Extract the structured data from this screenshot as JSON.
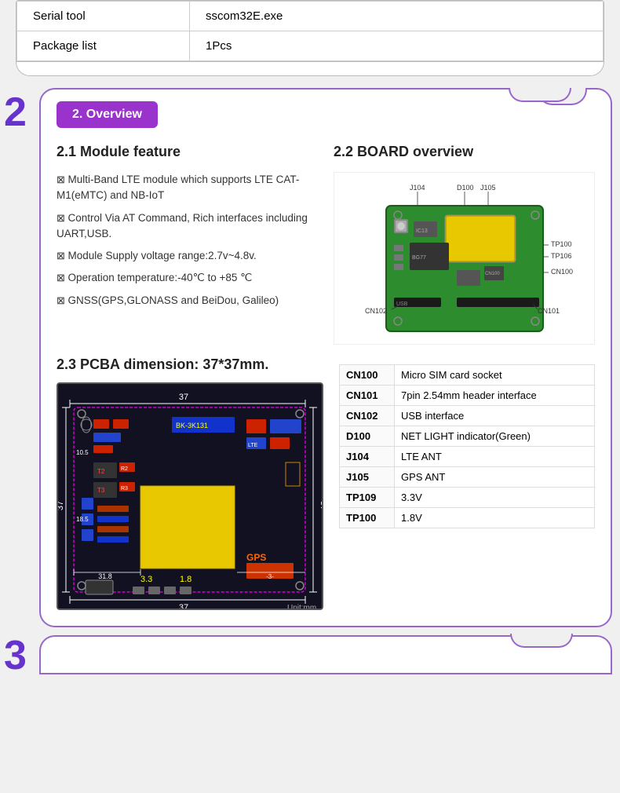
{
  "top_table": {
    "rows": [
      {
        "label": "Serial tool",
        "value": "sscom32E.exe"
      },
      {
        "label": "Package list",
        "value": "1Pcs"
      }
    ]
  },
  "section2": {
    "number": "2",
    "header": "2. Overview",
    "module_feature": {
      "title": "2.1 Module feature",
      "features": [
        "Multi-Band LTE module which supports LTE CAT-M1(eMTC) and NB-IoT",
        "Control Via AT Command, Rich interfaces including UART,USB.",
        "Module Supply voltage range:2.7v~4.8v.",
        "Operation temperature:-40℃ to +85 ℃",
        "GNSS(GPS,GLONASS and BeiDou, Galileo)"
      ]
    },
    "board_overview": {
      "title": "2.2 BOARD overview"
    },
    "pcba": {
      "title": "2.3 PCBA dimension: 37*37mm."
    },
    "component_table": {
      "rows": [
        {
          "label": "CN100",
          "desc": "Micro SIM card socket"
        },
        {
          "label": "CN101",
          "desc": "7pin 2.54mm header interface"
        },
        {
          "label": "CN102",
          "desc": "USB interface"
        },
        {
          "label": "D100",
          "desc": "NET LIGHT indicator(Green)"
        },
        {
          "label": "J104",
          "desc": "LTE ANT"
        },
        {
          "label": "J105",
          "desc": "GPS ANT"
        },
        {
          "label": "TP109",
          "desc": "3.3V"
        },
        {
          "label": "TP100",
          "desc": "1.8V"
        }
      ]
    }
  },
  "section3": {
    "number": "3"
  }
}
